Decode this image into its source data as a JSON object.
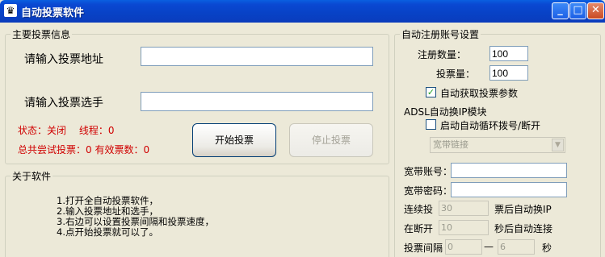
{
  "window": {
    "title": "自动投票软件",
    "min": "_",
    "max": "□",
    "close": "✕"
  },
  "main_info": {
    "legend": "主要投票信息",
    "url_label": "请输入投票地址",
    "url_value": "",
    "candidate_label": "请输入投票选手",
    "candidate_value": "",
    "status_line": "状态：关闭　 线程：0",
    "total_line": "总共尝试投票：0 有效票数：0",
    "start_button": "开始投票",
    "stop_button": "停止投票"
  },
  "about": {
    "legend": "关于软件",
    "lines": [
      "1.打开全自动投票软件，",
      "2.输入投票地址和选手，",
      "3.右边可以设置投票间隔和投票速度，",
      "4.点开始投票就可以了。"
    ]
  },
  "auto_register": {
    "legend": "自动注册账号设置",
    "reg_count_label": "注册数量：",
    "reg_count_value": "100",
    "vote_count_label": "投票量：",
    "vote_count_value": "100",
    "auto_params_label": "自动获取投票参数",
    "auto_params_checked": true,
    "adsl_title": "ADSL自动换IP模块",
    "dial_label": "启动自动循环拨号/断开",
    "dial_checked": false,
    "link_select": "宽带链接",
    "account_label": "宽带账号：",
    "password_label": "宽带密码：",
    "consecutive_label": "连续投",
    "consecutive_value": "30",
    "consecutive_suffix": "票后自动换IP",
    "disconnect_label": "在断开",
    "disconnect_value": "10",
    "disconnect_suffix": "秒后自动连接",
    "interval_label": "投票间隔",
    "interval_from": "0",
    "interval_dash": "—",
    "interval_to": "6",
    "interval_unit": "秒"
  }
}
